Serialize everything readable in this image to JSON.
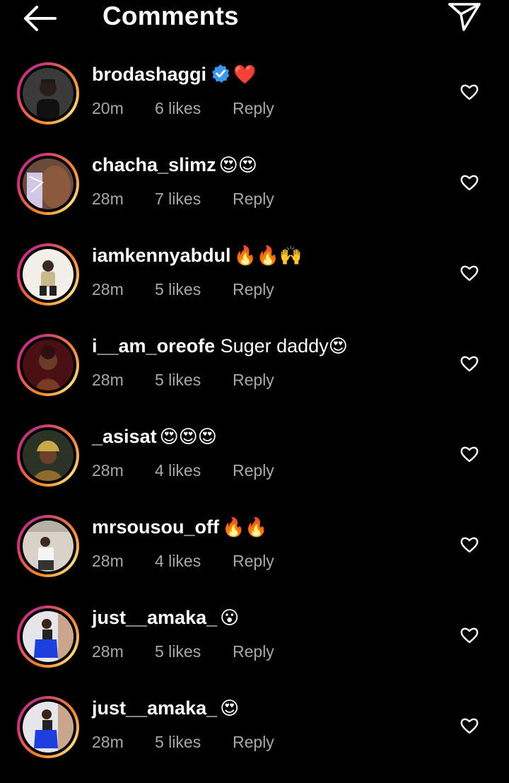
{
  "header": {
    "title": "Comments",
    "back_icon": "arrow-left-icon",
    "send_icon": "paper-plane-icon"
  },
  "comments": [
    {
      "username": "brodashaggi",
      "verified": true,
      "text": "",
      "emoji": "❤️",
      "time": "20m",
      "likes": "6 likes",
      "reply": "Reply",
      "avatar": "man-portrait"
    },
    {
      "username": "chacha_slimz",
      "verified": false,
      "text": "",
      "emoji": "😍😍",
      "time": "28m",
      "likes": "7 likes",
      "reply": "Reply",
      "avatar": "woman-back"
    },
    {
      "username": "iamkennyabdul",
      "verified": false,
      "text": "",
      "emoji": "🔥🔥🙌",
      "time": "28m",
      "likes": "5 likes",
      "reply": "Reply",
      "avatar": "man-white-bg"
    },
    {
      "username": "i__am_oreofe",
      "verified": false,
      "text": " Suger daddy",
      "emoji": "😍",
      "time": "28m",
      "likes": "5 likes",
      "reply": "Reply",
      "avatar": "woman-red"
    },
    {
      "username": "_asisat",
      "verified": false,
      "text": "",
      "emoji": "😍😍😍",
      "time": "28m",
      "likes": "4 likes",
      "reply": "Reply",
      "avatar": "woman-headwrap"
    },
    {
      "username": "mrsousou_off",
      "verified": false,
      "text": "",
      "emoji": "🔥🔥",
      "time": "28m",
      "likes": "4 likes",
      "reply": "Reply",
      "avatar": "man-room"
    },
    {
      "username": "just__amaka_",
      "verified": false,
      "text": "",
      "emoji": "😮",
      "time": "28m",
      "likes": "5 likes",
      "reply": "Reply",
      "avatar": "woman-blue"
    },
    {
      "username": "just__amaka_",
      "verified": false,
      "text": "",
      "emoji": "😍",
      "time": "28m",
      "likes": "5 likes",
      "reply": "Reply",
      "avatar": "woman-blue"
    }
  ],
  "colors": {
    "background": "#000000",
    "meta": "#a8a8a8",
    "verified": "#3897f0",
    "ring_start": "#f58529",
    "ring_end": "#dd2a7b"
  }
}
